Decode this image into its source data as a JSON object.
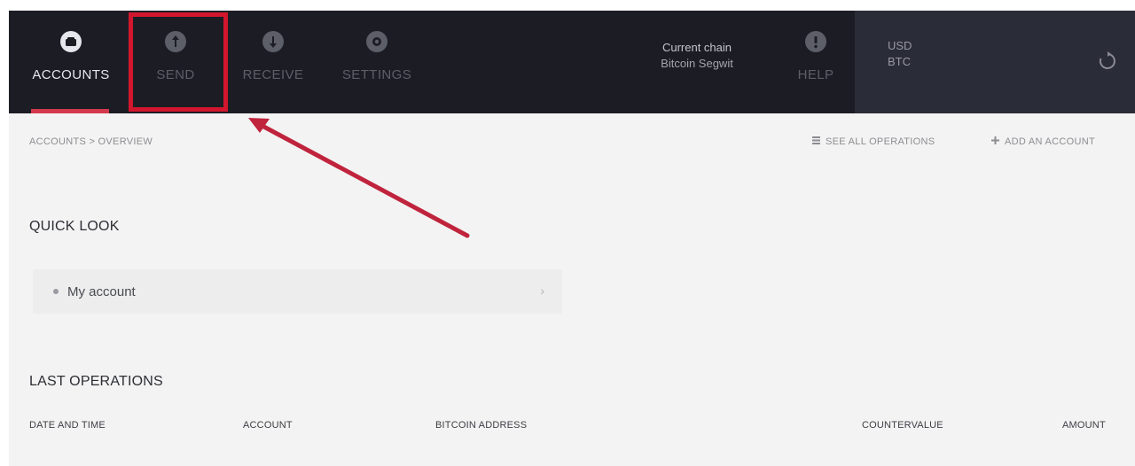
{
  "nav": {
    "items": [
      {
        "id": "accounts",
        "label": "ACCOUNTS",
        "icon": "wallet-icon",
        "active": true
      },
      {
        "id": "send",
        "label": "SEND",
        "icon": "send-icon",
        "active": false
      },
      {
        "id": "receive",
        "label": "RECEIVE",
        "icon": "receive-icon",
        "active": false
      },
      {
        "id": "settings",
        "label": "SETTINGS",
        "icon": "gear-icon",
        "active": false
      }
    ],
    "help_label": "HELP"
  },
  "chain": {
    "line1": "Current chain",
    "line2": "Bitcoin Segwit"
  },
  "currencies": {
    "fiat": "USD",
    "crypto": "BTC"
  },
  "breadcrumb": "ACCOUNTS > OVERVIEW",
  "actions": {
    "see_all": "SEE ALL OPERATIONS",
    "add_account": "ADD AN ACCOUNT"
  },
  "quick_look": {
    "title": "QUICK LOOK",
    "account_name": "My account"
  },
  "last_operations": {
    "title": "LAST OPERATIONS",
    "columns": [
      "DATE AND TIME",
      "ACCOUNT",
      "BITCOIN ADDRESS",
      "COUNTERVALUE",
      "AMOUNT"
    ]
  },
  "colors": {
    "accent": "#d3394d",
    "highlight": "#d2162d",
    "topbar": "#1c1d24"
  }
}
